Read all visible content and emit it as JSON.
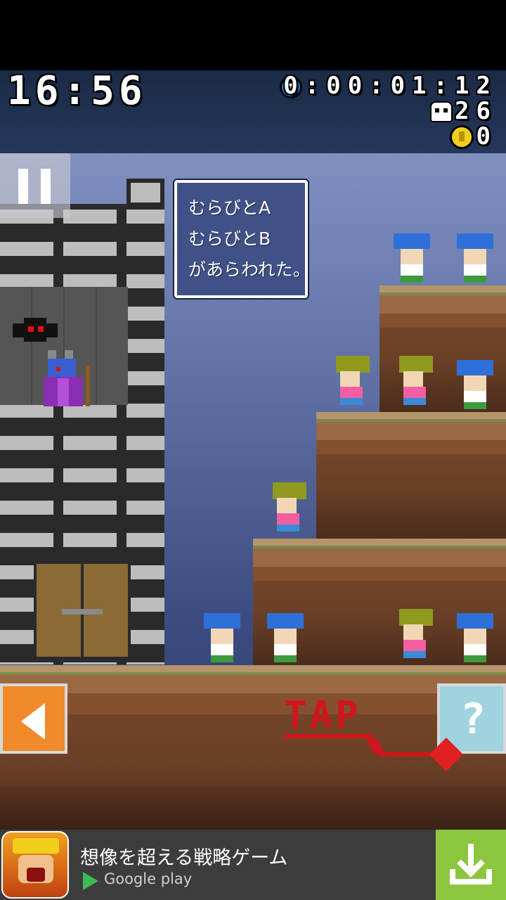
{
  "hud": {
    "clock": "16:56",
    "elapsed": "0:00:01:12",
    "deaths": "26",
    "coins": "0",
    "elapsed_icon": "stopwatch-icon",
    "deaths_icon": "skull-icon",
    "coins_icon": "coin-icon"
  },
  "message": {
    "lines": [
      "むらびとA",
      "むらびとB",
      "があらわれた。"
    ]
  },
  "controls": {
    "pause_icon": "pause-icon",
    "back_icon": "left-arrow-icon",
    "help_label": "?",
    "tap_label": "TAP"
  },
  "ad": {
    "title": "想像を超える戦略ゲーム",
    "store": "Google play",
    "download_icon": "download-icon"
  },
  "colors": {
    "hud_bg": "#1b2a45",
    "sky": "#5e6fa4",
    "dirt": "#8a5a3a",
    "tap_red": "#d0151c",
    "back_orange": "#f08a2a",
    "help_blue": "#9fd3e0",
    "ad_green": "#8cc63e"
  }
}
